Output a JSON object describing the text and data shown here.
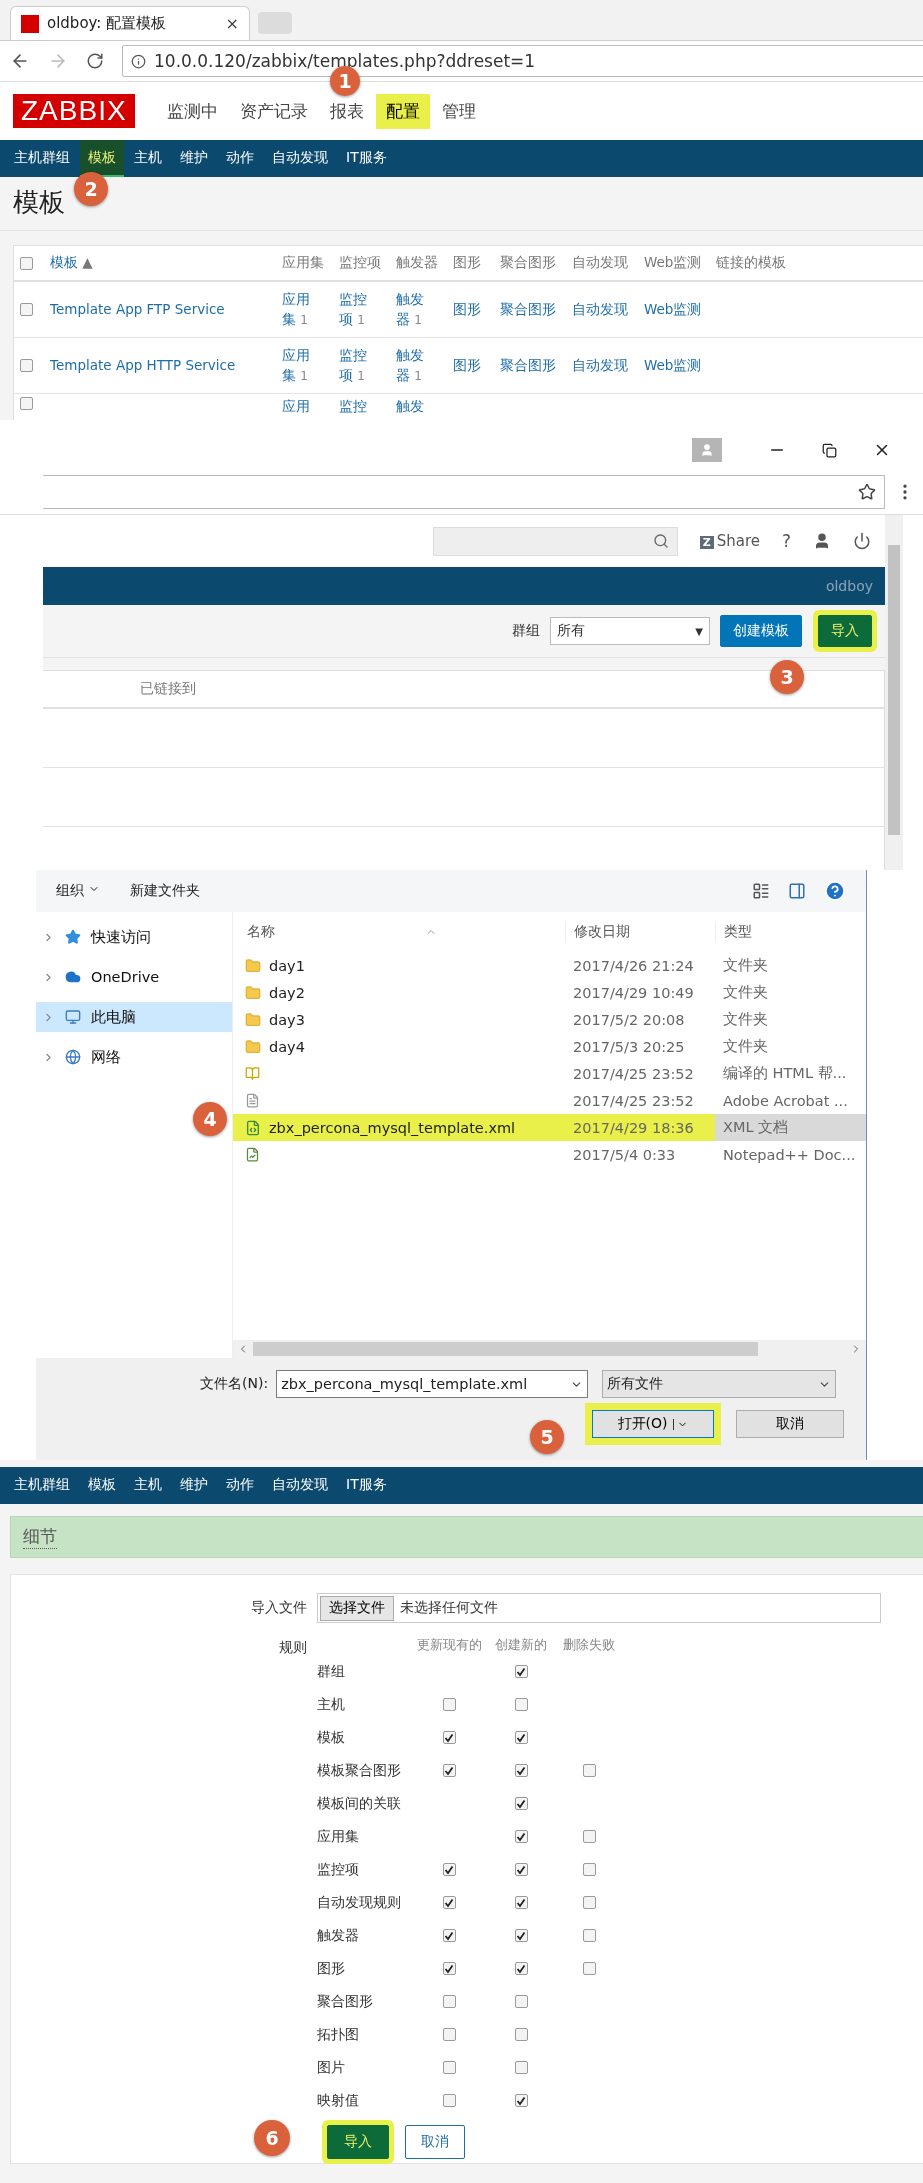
{
  "markers": [
    "1",
    "2",
    "3",
    "4",
    "5",
    "6"
  ],
  "browser": {
    "tab_title": "oldboy: 配置模板",
    "tab_close": "×",
    "url": "10.0.0.120/zabbix/templates.php?ddreset=1"
  },
  "logo": "ZABBIX",
  "main_menu": [
    {
      "label": "监测中",
      "selected": false,
      "highlighted": false
    },
    {
      "label": "资产记录",
      "selected": false,
      "highlighted": false
    },
    {
      "label": "报表",
      "selected": false,
      "highlighted": false
    },
    {
      "label": "配置",
      "selected": true,
      "highlighted": true
    },
    {
      "label": "管理",
      "selected": false,
      "highlighted": false
    }
  ],
  "sub_menu": [
    {
      "label": "主机群组",
      "selected": false
    },
    {
      "label": "模板",
      "selected": true
    },
    {
      "label": "主机",
      "selected": false
    },
    {
      "label": "维护",
      "selected": false
    },
    {
      "label": "动作",
      "selected": false
    },
    {
      "label": "自动发现",
      "selected": false
    },
    {
      "label": "IT服务",
      "selected": false
    }
  ],
  "page_title": "模板",
  "templates_table": {
    "header_checked": false,
    "sort_mark": "▲",
    "columns": [
      "模板",
      "应用集",
      "监控项",
      "触发器",
      "图形",
      "聚合图形",
      "自动发现",
      "Web监测",
      "链接的模板"
    ],
    "rows": [
      {
        "checked": false,
        "cells": [
          {
            "text": "Template App FTP Service"
          },
          {
            "text": "应用集",
            "count": "1"
          },
          {
            "text": "监控项",
            "count": "1"
          },
          {
            "text": "触发器",
            "count": "1"
          },
          {
            "text": "图形"
          },
          {
            "text": "聚合图形"
          },
          {
            "text": "自动发现"
          },
          {
            "text": "Web监测"
          }
        ]
      },
      {
        "checked": false,
        "cells": [
          {
            "text": "Template App HTTP Service"
          },
          {
            "text": "应用集",
            "count": "1"
          },
          {
            "text": "监控项",
            "count": "1"
          },
          {
            "text": "触发器",
            "count": "1"
          },
          {
            "text": "图形"
          },
          {
            "text": "聚合图形"
          },
          {
            "text": "自动发现"
          },
          {
            "text": "Web监测"
          }
        ]
      },
      {
        "checked": false,
        "cells": [
          {},
          {
            "text": "应用"
          },
          {
            "text": "监控"
          },
          {
            "text": "触发"
          }
        ]
      }
    ]
  },
  "second_window": {
    "share_logo": "Z",
    "share": "Share",
    "help": "?",
    "user": "oldboy",
    "group_label": "群组",
    "group_value": "所有",
    "group_caret": "▼",
    "create_button": "创建模板",
    "import_button": {
      "label": "导入",
      "highlighted": true
    },
    "table_header": "已链接到"
  },
  "file_dialog": {
    "organize": "组织",
    "new_folder": "新建文件夹",
    "nav": [
      {
        "label": "快速访问",
        "kind": "star",
        "selected": false
      },
      {
        "label": "OneDrive",
        "kind": "cloud",
        "selected": false
      },
      {
        "label": "此电脑",
        "kind": "computer",
        "selected": true
      },
      {
        "label": "网络",
        "kind": "network",
        "selected": false
      }
    ],
    "columns": [
      "名称",
      "修改日期",
      "类型"
    ],
    "files": [
      {
        "kind": "folder",
        "name": "day1",
        "date": "2017/4/26 21:24",
        "type": "文件夹",
        "selected": false,
        "highlighted": false
      },
      {
        "kind": "folder",
        "name": "day2",
        "date": "2017/4/29 10:49",
        "type": "文件夹",
        "selected": false,
        "highlighted": false
      },
      {
        "kind": "folder",
        "name": "day3",
        "date": "2017/5/2 20:08",
        "type": "文件夹",
        "selected": false,
        "highlighted": false
      },
      {
        "kind": "folder",
        "name": "day4",
        "date": "2017/5/3 20:25",
        "type": "文件夹",
        "selected": false,
        "highlighted": false
      },
      {
        "kind": "help",
        "date": "2017/4/25 23:52",
        "type": "编译的 HTML 帮...",
        "selected": false,
        "highlighted": false
      },
      {
        "kind": "document",
        "date": "2017/4/25 23:52",
        "type": "Adobe Acrobat ...",
        "selected": false,
        "highlighted": false
      },
      {
        "kind": "xml",
        "name": "zbx_percona_mysql_template.xml",
        "date": "2017/4/29 18:36",
        "type": "XML 文档",
        "selected": true,
        "highlighted": true
      },
      {
        "kind": "chart",
        "date": "2017/5/4 0:33",
        "type": "Notepad++ Doc...",
        "selected": false,
        "highlighted": false
      }
    ],
    "filename_label": "文件名(N):",
    "filename": "zbx_percona_mysql_template.xml",
    "filter": "所有文件",
    "open_button": {
      "label": "打开(O)",
      "highlighted": true
    },
    "cancel_button": "取消"
  },
  "import_page": {
    "sub_menu": [
      "主机群组",
      "模板",
      "主机",
      "维护",
      "动作",
      "自动发现",
      "IT服务"
    ],
    "banner": "细节",
    "file_label": "导入文件",
    "choose_button": "选择文件",
    "no_file": "未选择任何文件",
    "rules_label": "规则",
    "rule_columns": [
      "更新现有的",
      "创建新的",
      "删除失败"
    ],
    "rules": [
      {
        "label": "群组",
        "create": true
      },
      {
        "label": "主机",
        "update": false,
        "create": false
      },
      {
        "label": "模板",
        "update": true,
        "create": true
      },
      {
        "label": "模板聚合图形",
        "update": true,
        "create": true,
        "delete": false
      },
      {
        "label": "模板间的关联",
        "create": true
      },
      {
        "label": "应用集",
        "create": true,
        "delete": false
      },
      {
        "label": "监控项",
        "update": true,
        "create": true,
        "delete": false
      },
      {
        "label": "自动发现规则",
        "update": true,
        "create": true,
        "delete": false
      },
      {
        "label": "触发器",
        "update": true,
        "create": true,
        "delete": false
      },
      {
        "label": "图形",
        "update": true,
        "create": true,
        "delete": false
      },
      {
        "label": "聚合图形",
        "update": false,
        "create": false
      },
      {
        "label": "拓扑图",
        "update": false,
        "create": false
      },
      {
        "label": "图片",
        "update": false,
        "create": false
      },
      {
        "label": "映射值",
        "update": false,
        "create": true
      }
    ],
    "submit_button": {
      "label": "导入",
      "highlighted": true
    },
    "cancel_button": "取消"
  }
}
